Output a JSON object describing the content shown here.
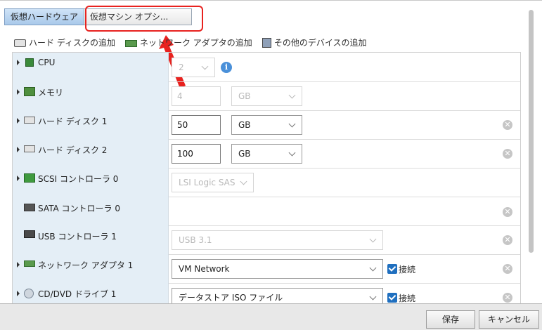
{
  "tabs": [
    {
      "label": "仮想ハードウェア",
      "active": true
    },
    {
      "label": "仮想マシン オプシ...",
      "active": false
    }
  ],
  "toolbar": {
    "add_disk": "ハード ディスクの追加",
    "add_network": "ネットワーク アダプタの追加",
    "add_other": "その他のデバイスの追加"
  },
  "rows": {
    "cpu": {
      "label": "CPU",
      "value": "2"
    },
    "memory": {
      "label": "メモリ",
      "value": "4",
      "unit": "GB"
    },
    "disk1": {
      "label": "ハード ディスク 1",
      "value": "50",
      "unit": "GB"
    },
    "disk2": {
      "label": "ハード ディスク 2",
      "value": "100",
      "unit": "GB"
    },
    "scsi": {
      "label": "SCSI コントローラ 0",
      "value": "LSI Logic SAS"
    },
    "sata": {
      "label": "SATA コントローラ 0"
    },
    "usb": {
      "label": "USB コントローラ 1",
      "value": "USB 3.1"
    },
    "network": {
      "label": "ネットワーク アダプタ 1",
      "value": "VM Network",
      "connect_label": "接続",
      "connected": true
    },
    "cdrom": {
      "label": "CD/DVD ドライブ 1",
      "value": "データストア ISO ファイル",
      "connect_label": "接続",
      "connected": true
    }
  },
  "footer": {
    "save": "保存",
    "cancel": "キャンセル"
  },
  "colors": {
    "highlight": "#e8221f",
    "accent": "#1f6fbf",
    "label_bg": "#e4eef6"
  }
}
